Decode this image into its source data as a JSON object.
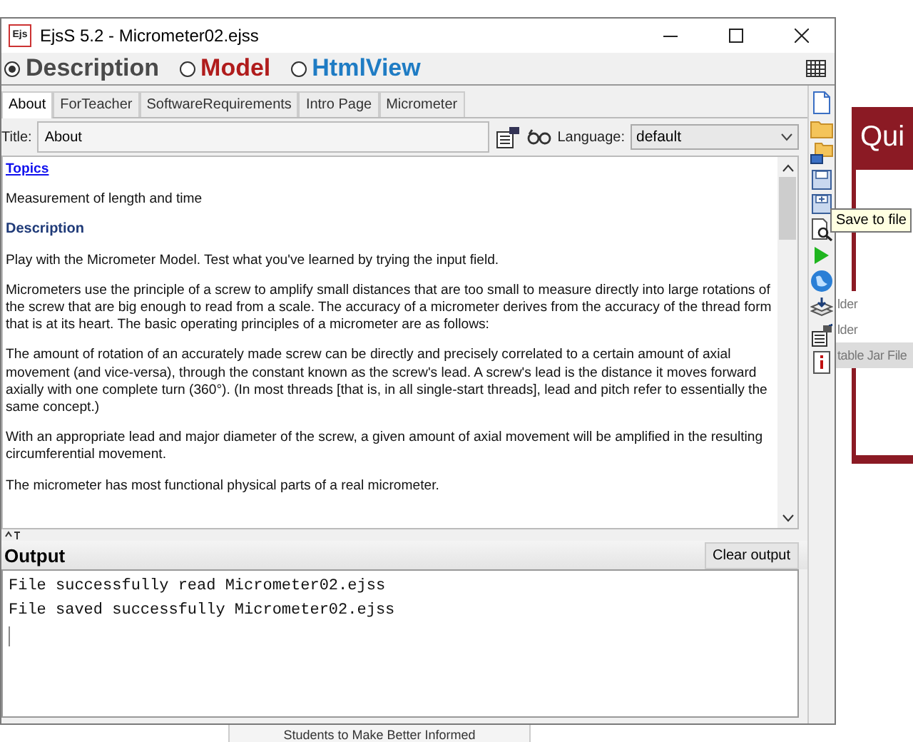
{
  "window": {
    "app_icon": "Ejs",
    "title": "EjsS 5.2 - Micrometer02.ejss"
  },
  "modes": [
    {
      "label": "Description",
      "selected": true,
      "color": "#4a4a4a"
    },
    {
      "label": "Model",
      "selected": false,
      "color": "#b01c1c"
    },
    {
      "label": "HtmlView",
      "selected": false,
      "color": "#1f7cc4"
    }
  ],
  "tabs": [
    {
      "label": "About",
      "selected": true
    },
    {
      "label": "ForTeacher",
      "selected": false
    },
    {
      "label": "SoftwareRequirements",
      "selected": false
    },
    {
      "label": "Intro Page",
      "selected": false
    },
    {
      "label": "Micrometer",
      "selected": false
    }
  ],
  "title_field": {
    "label": "Title:",
    "value": "About"
  },
  "language": {
    "label": "Language:",
    "value": "default"
  },
  "content": [
    {
      "kind": "link",
      "text": "Topics"
    },
    {
      "kind": "text",
      "text": "Measurement of length and time"
    },
    {
      "kind": "heading",
      "text": "Description"
    },
    {
      "kind": "text",
      "text": "Play with the Micrometer Model. Test what you've learned by trying the input field."
    },
    {
      "kind": "text",
      "text": "Micrometers use the principle of a screw to amplify small distances that are too small to measure directly into large rotations of the screw that are big enough to read from a scale. The accuracy of a micrometer derives from the accuracy of the thread form that is at its heart. The basic operating principles of a micrometer are as follows:"
    },
    {
      "kind": "text",
      "text": "The amount of rotation of an accurately made screw can be directly and precisely correlated to a certain amount of axial movement (and vice-versa), through the constant known as the screw's lead. A screw's lead is the distance it moves forward axially with one complete turn (360°). (In most threads [that is, in all single-start threads], lead and pitch refer to essentially the same concept.)"
    },
    {
      "kind": "text",
      "text": "With an appropriate lead and major diameter of the screw, a given amount of axial movement will be amplified in the resulting circumferential movement."
    },
    {
      "kind": "text",
      "text": "The micrometer has most functional physical parts of a real micrometer."
    }
  ],
  "output": {
    "title": "Output",
    "clear_button": "Clear output",
    "lines": [
      "File successfully read Micrometer02.ejss",
      "File saved successfully Micrometer02.ejss"
    ]
  },
  "tooltip": "Save to file",
  "backdrop": {
    "banner": "Qui",
    "menu": [
      {
        "label": "lder",
        "selected": false
      },
      {
        "label": "lder",
        "selected": false
      },
      {
        "label": "table Jar File",
        "selected": true
      }
    ],
    "footer": "Students to Make Better Informed"
  }
}
